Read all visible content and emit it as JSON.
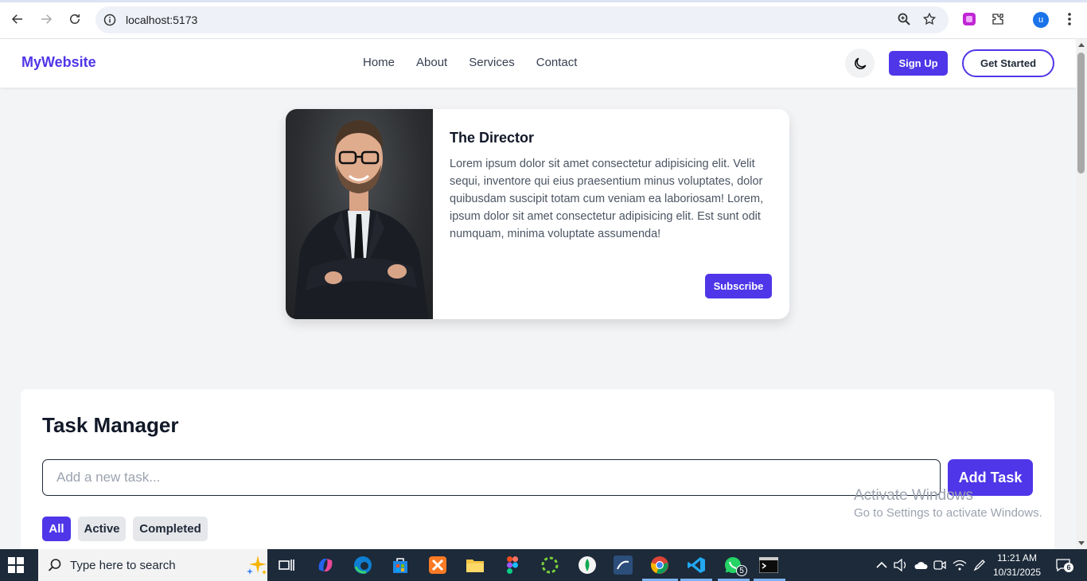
{
  "browser": {
    "url": "localhost:5173",
    "profile_initial": "u"
  },
  "header": {
    "logo": "MyWebsite",
    "nav": [
      "Home",
      "About",
      "Services",
      "Contact"
    ],
    "signup_label": "Sign Up",
    "get_started_label": "Get Started"
  },
  "profile_card": {
    "title": "The Director",
    "body": "Lorem ipsum dolor sit amet consectetur adipisicing elit. Velit sequi, inventore qui eius praesentium minus voluptates, dolor quibusdam suscipit totam cum veniam ea laboriosam! Lorem, ipsum dolor sit amet consectetur adipisicing elit. Est sunt odit numquam, minima voluptate assumenda!",
    "subscribe_label": "Subscribe"
  },
  "task_manager": {
    "title": "Task Manager",
    "input_placeholder": "Add a new task...",
    "add_label": "Add Task",
    "filters": [
      "All",
      "Active",
      "Completed"
    ],
    "selected_filter": "All"
  },
  "watermark": {
    "line1": "Activate Windows",
    "line2": "Go to Settings to activate Windows."
  },
  "taskbar": {
    "search_placeholder": "Type here to search",
    "time": "11:21 AM",
    "date": "10/31/2025",
    "notification_count": "6",
    "whatsapp_badge": "5"
  },
  "colors": {
    "accent": "#4f36e8",
    "page_bg": "#f3f4f6",
    "taskbar_bg": "#1c2a3a"
  }
}
